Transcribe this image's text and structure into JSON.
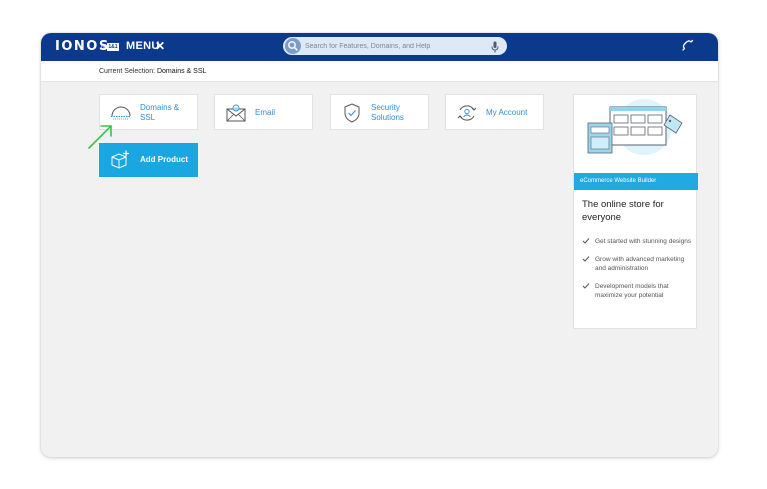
{
  "header": {
    "logo_text": "IONOS",
    "logo_by": "by",
    "logo_badge": "1&1",
    "menu_label": "MENU",
    "close_glyph": "✕",
    "search_placeholder": "Search for Features, Domains, and Help",
    "colors": {
      "bar": "#0b3a8c",
      "search_bg": "#dfe8f5"
    }
  },
  "selection": {
    "label": "Current Selection:",
    "value": "Domains & SSL"
  },
  "tiles": [
    {
      "label_line1": "Domains &",
      "label_line2": "SSL",
      "icon": "globe-icon"
    },
    {
      "label_line1": "Email",
      "icon": "envelope-icon"
    },
    {
      "label_line1": "Security",
      "label_line2": "Solutions",
      "icon": "shield-check-icon"
    },
    {
      "label_line1": "My Account",
      "icon": "user-cycle-icon"
    }
  ],
  "add_product": {
    "label": "Add Product",
    "icon": "box-plus-icon",
    "color": "#1aa6e0"
  },
  "promo": {
    "band_label": "eCommerce Website Builder",
    "title": "The online store for everyone",
    "items": [
      "Get started with stunning designs",
      "Grow with advanced marketing and administration",
      "Development models that maximize your potential"
    ],
    "accent": "#21a9e1"
  },
  "annotation": {
    "arrow_color": "#3cc24a"
  }
}
